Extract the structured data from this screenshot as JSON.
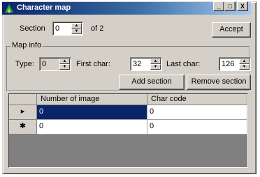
{
  "window": {
    "title": "Character map"
  },
  "titlebar_buttons": {
    "minimize": "_",
    "maximize": "□",
    "close": "X"
  },
  "section": {
    "label": "Section",
    "value": "0",
    "of_label": "of 2"
  },
  "accept_button": "Accept",
  "map_info": {
    "legend": "Map info",
    "type_label": "Type:",
    "type_value": "0",
    "first_char_label": "First char:",
    "first_char_value": "32",
    "last_char_label": "Last char:",
    "last_char_value": "126"
  },
  "add_section_button": "Add section",
  "remove_section_button": "Remove section",
  "grid": {
    "columns": [
      "Number of image",
      "Char code"
    ],
    "rows": [
      {
        "marker": "▸",
        "cells": [
          "0",
          "0"
        ],
        "selected": true
      },
      {
        "marker": "✱",
        "cells": [
          "0",
          "0"
        ],
        "selected": false
      }
    ]
  },
  "colors": {
    "title_active": "#0a246a",
    "face": "#d4d0c8",
    "selection": "#0a246a"
  }
}
